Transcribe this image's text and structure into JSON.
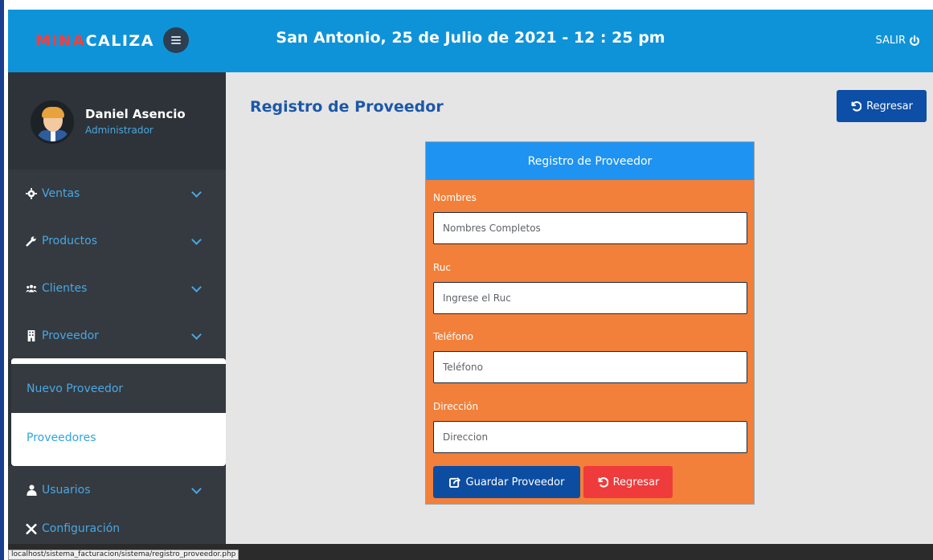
{
  "header": {
    "brand_part1": "MINA",
    "brand_part2": "CALIZA",
    "date_title": "San Antonio, 25 de Julio de 2021 - 12 : 25 pm",
    "logout_label": "SALIR"
  },
  "user": {
    "name": "Daniel Asencio",
    "role": "Administrador"
  },
  "sidebar": {
    "items": [
      {
        "label": "Ventas",
        "icon": "gear-icon"
      },
      {
        "label": "Productos",
        "icon": "wrench-icon"
      },
      {
        "label": "Clientes",
        "icon": "users-icon"
      },
      {
        "label": "Proveedor",
        "icon": "building-icon"
      },
      {
        "label": "Usuarios",
        "icon": "user-icon"
      },
      {
        "label": "Configuración",
        "icon": "tools-icon"
      }
    ],
    "submenu": [
      {
        "label": "Nuevo Proveedor"
      },
      {
        "label": "Proveedores"
      }
    ]
  },
  "main": {
    "page_title": "Registro de Proveedor",
    "back_label": "Regresar"
  },
  "form": {
    "header": "Registro de Proveedor",
    "fields": [
      {
        "label": "Nombres",
        "placeholder": "Nombres Completos"
      },
      {
        "label": "Ruc",
        "placeholder": "Ingrese el Ruc"
      },
      {
        "label": "Teléfono",
        "placeholder": "Teléfono"
      },
      {
        "label": "Dirección",
        "placeholder": "Direccion"
      }
    ],
    "save_label": "Guardar Proveedor",
    "back_label": "Regresar"
  },
  "status_bar": {
    "url": "localhost/sistema_facturacion/sistema/registro_proveedor.php"
  },
  "colors": {
    "header_blue": "#0f93d8",
    "sidebar_dark": "#343a40",
    "link_blue": "#4aa7e3",
    "form_orange": "#f2803a",
    "form_header_blue": "#1e93f1",
    "primary_button": "#0c4da2",
    "danger_button": "#ef3b3b",
    "brand_red": "#ff3b3b"
  }
}
